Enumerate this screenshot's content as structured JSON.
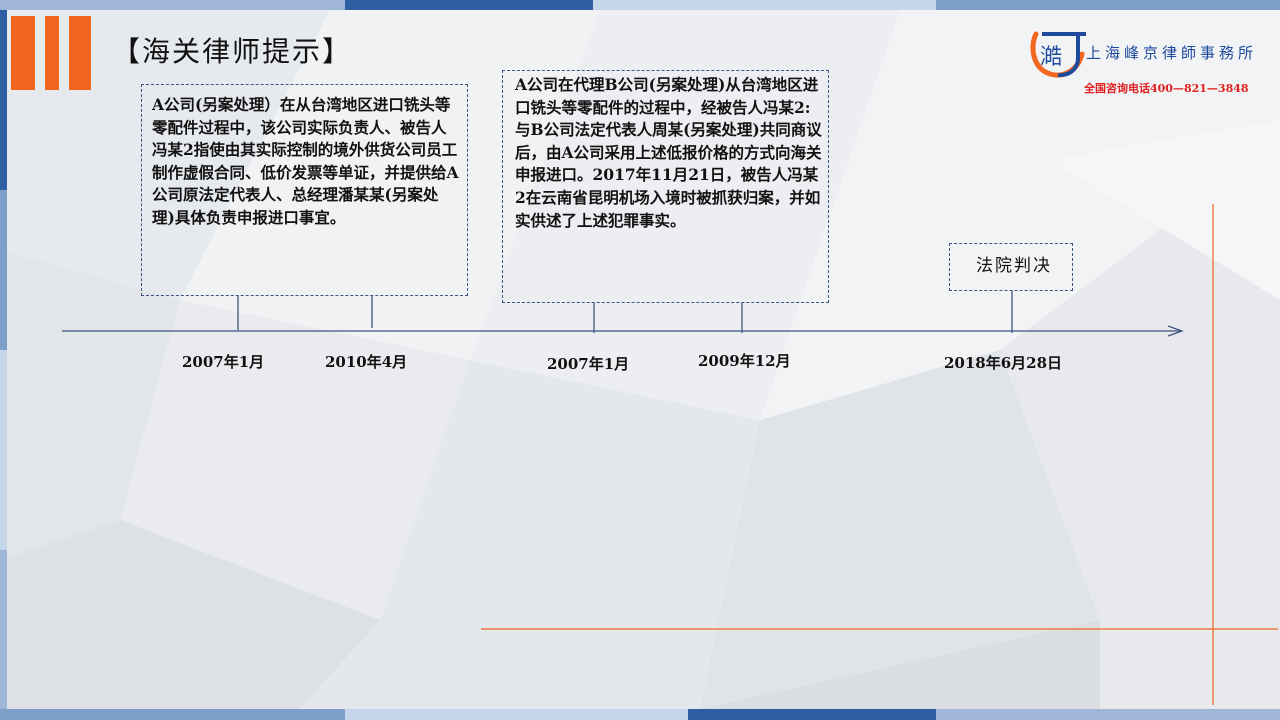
{
  "slide": {
    "title": "【海关律师提示】",
    "logo": {
      "icon_name": "law-firm-logo-icon",
      "glyph": "澔",
      "name": "上海峰京律師事務所",
      "phone": "全国咨询电话400—821—3848"
    },
    "events": [
      {
        "text": "A公司(另案处理）在从台湾地区进口铣头等零配件过程中，该公司实际负责人、被告人冯某2指使由其实际控制的境外供货公司员工制作虚假合同、低价发票等单证，并提供给A公司原法定代表人、总经理潘某某(另案处理)具体负责申报进口事宜。"
      },
      {
        "text": "A公司在代理B公司(另案处理)从台湾地区进口铣头等零配件的过程中，经被告人冯某2:与B公司法定代表人周某(另案处理)共同商议后，由A公司采用上述低报价格的方式向海关申报进口。2017年11月21日，被告人冯某2在云南省昆明机场入境时被抓获归案，并如实供述了上述犯罪事实。"
      },
      {
        "text": "法院判决"
      }
    ],
    "dates": [
      "2007年1月",
      "2010年4月",
      "2007年1月",
      "2009年12月",
      "2018年6月28日"
    ]
  },
  "colors": {
    "accent_orange": "#f2661f",
    "timeline_blue": "#3c5580",
    "logo_blue": "#1e4a9c",
    "phone_red": "#e02020"
  }
}
